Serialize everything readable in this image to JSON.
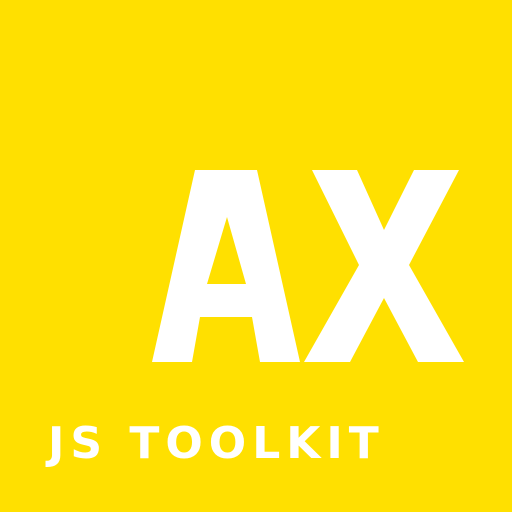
{
  "logo": {
    "mark_text": "AX",
    "tagline": "JS TOOLKIT",
    "background_color": "#FFE000",
    "foreground_color": "#FFFFFF"
  }
}
